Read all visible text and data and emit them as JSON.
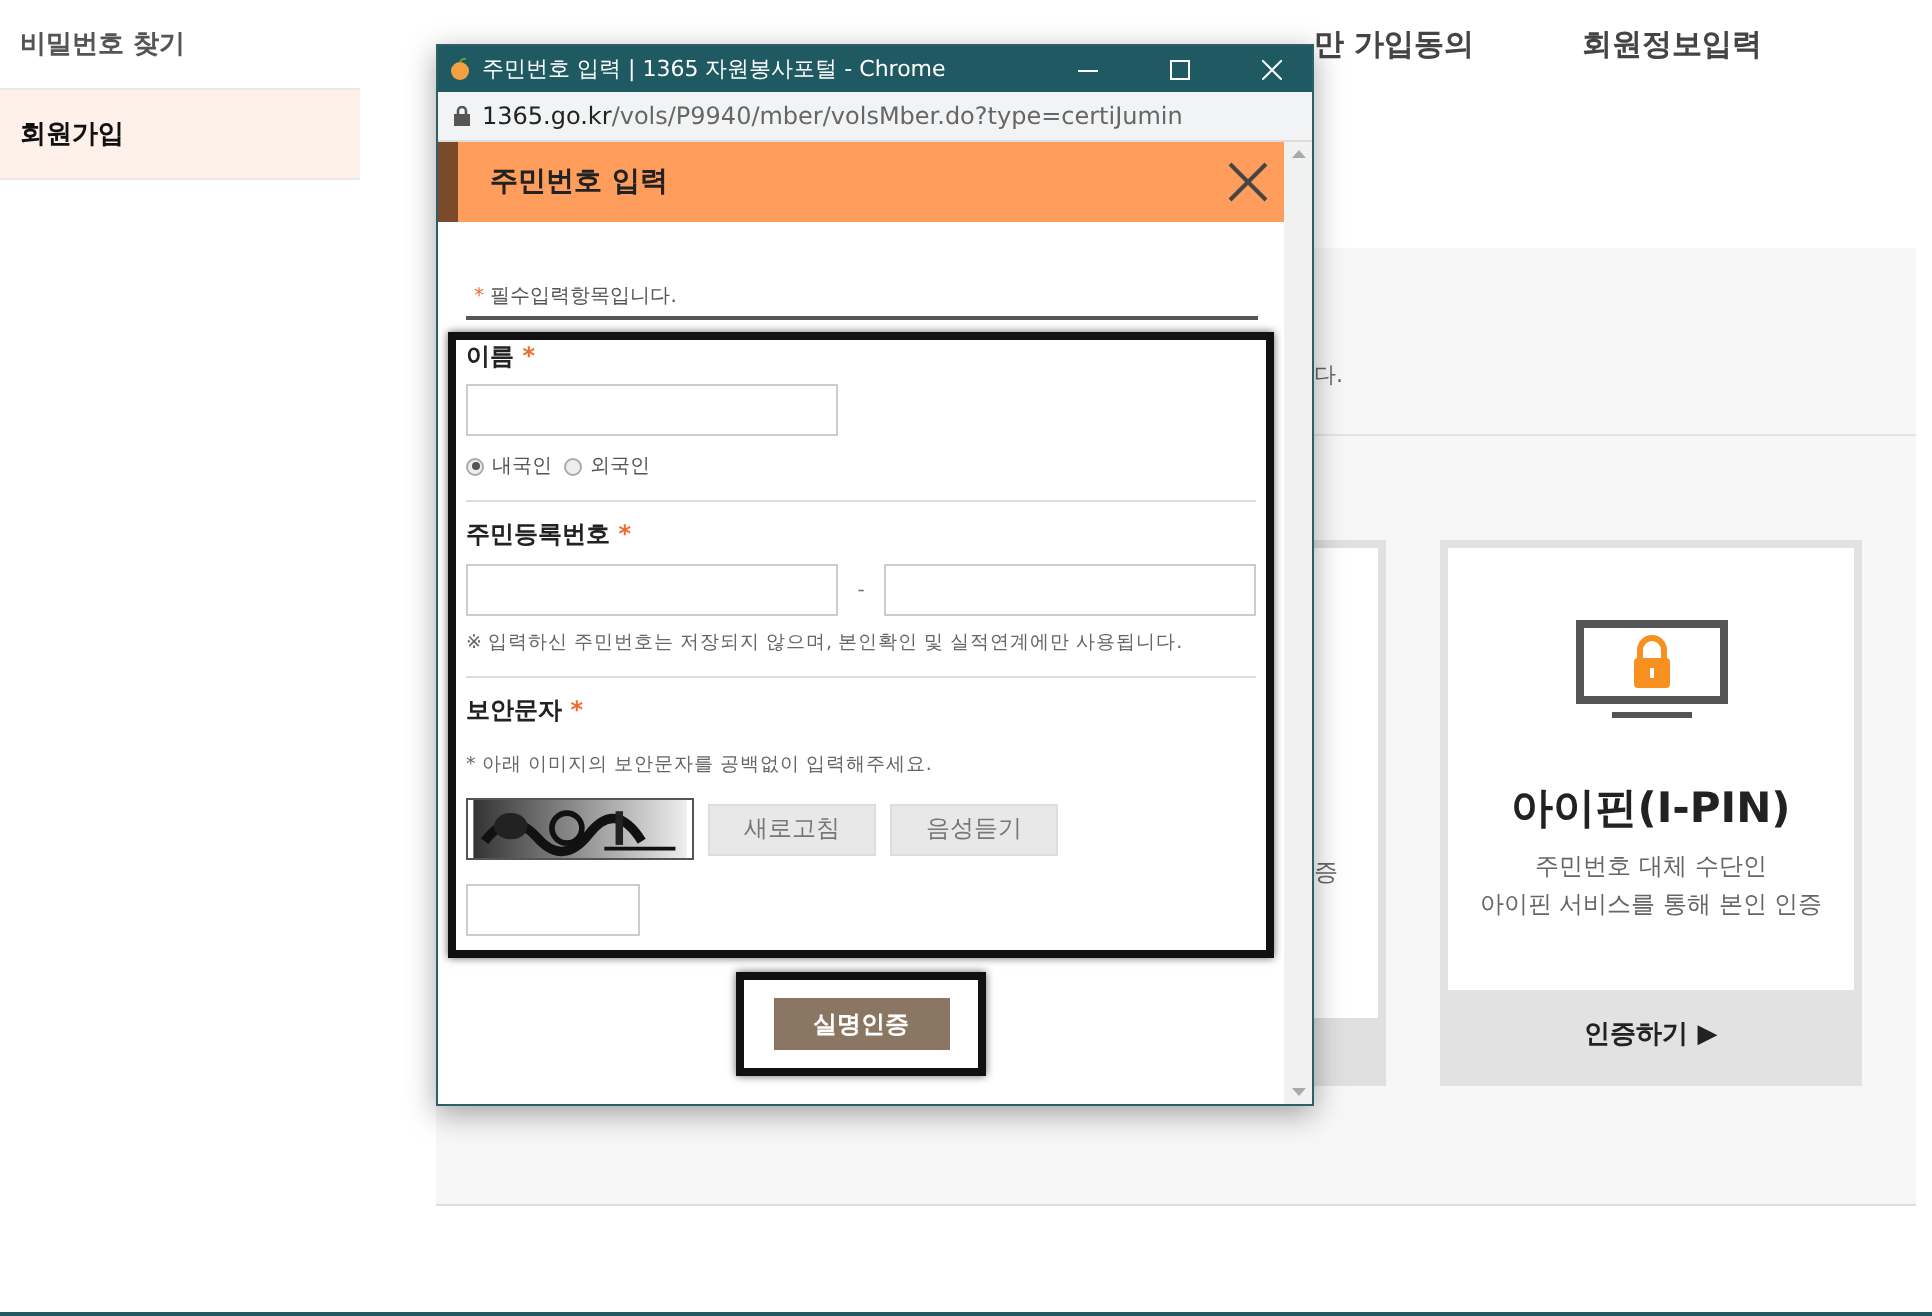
{
  "sidebar": {
    "items": [
      {
        "label": "비밀번호 찾기",
        "selected": false
      },
      {
        "label": "회원가입",
        "selected": true
      }
    ]
  },
  "steps": [
    {
      "label": "만 가입동의"
    },
    {
      "label": "회원정보입력"
    }
  ],
  "panel": {
    "notice_fragment": "다.",
    "partial_card": {
      "description_fragment": "증"
    },
    "card": {
      "title": "아이핀(I-PIN)",
      "description": [
        "주민번호 대체 수단인",
        "아이핀 서비스를 통해 본인 인증"
      ],
      "action": "인증하기",
      "action_icon": "▶"
    }
  },
  "popup": {
    "window_title": "주민번호 입력 | 1365 자원봉사포털 - Chrome",
    "url_host": "1365.go.kr",
    "url_path": "/vols/P9940/mber/volsMber.do?type=certiJumin",
    "header": "주민번호 입력",
    "required_mark": "*",
    "required_note": "필수입력항목입니다.",
    "name": {
      "label": "이름",
      "mark": "*",
      "radios": [
        {
          "label": "내국인",
          "selected": true
        },
        {
          "label": "외국인",
          "selected": false
        }
      ]
    },
    "rrn": {
      "label": "주민등록번호",
      "mark": "*",
      "separator": "-",
      "note": "※  입력하신 주민번호는 저장되지 않으며, 본인확인 및 실적연계에만 사용됩니다."
    },
    "captcha": {
      "label": "보안문자",
      "mark": "*",
      "note": "* 아래 이미지의 보안문자를 공백없이 입력해주세요.",
      "buttons": [
        "새로고침",
        "음성듣기"
      ]
    },
    "submit": "실명인증"
  }
}
